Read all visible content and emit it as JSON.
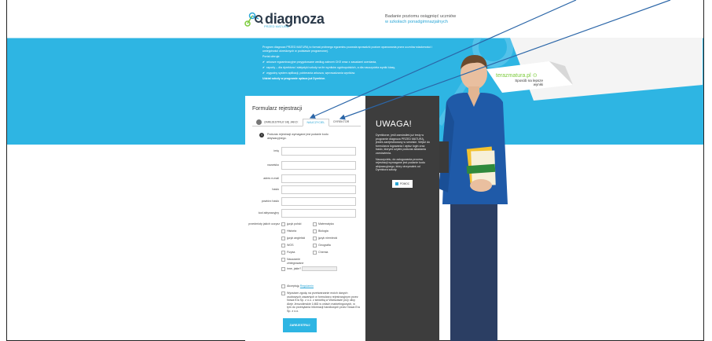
{
  "header": {
    "logo_text": "diagnoza",
    "logo_sub": "PRZED MATURĄ",
    "tagline_line1": "Badanie poziomu osiągnięć uczniów",
    "tagline_line2": "w szkołach ponadgimnazjalnych"
  },
  "banner": {
    "intro": "Program diagnoza PRZED MATURĄ to format próbnego egzaminu pozwala sprawdzić poziom opanowania przez uczniów wiadomości i umiejętności określonych w podstawie programowej.",
    "portal_heading": "Portal oferuje:",
    "features": [
      "arkusze egzaminacyjne przygotowane według zaleceń CKE wraz z zasadami oceniania,",
      "raporty – dla dyrektora i statystyki szkoły na tle wyników ogólnopolskich, a dla nauczyciela wyniki klasy,",
      "wygodny system aplikacji, pobierania arkusza, wprowadzania wyników."
    ],
    "closing": "Udział szkoły w programie opłaca już Dyrektor.",
    "partner_logo": "terazmatura.pl",
    "partner_sub": "Sposób na lepsze wyniki"
  },
  "form": {
    "title": "Formularz rejestracji",
    "tabs": [
      {
        "label": "ZAREJESTRUJ SIĘ JAKO:"
      },
      {
        "label": "NAUCZYCIEL"
      },
      {
        "label": "DYREKTOR"
      }
    ],
    "info": "Podczas rejestracji wymagane jest podanie kodu aktywacyjnego.",
    "fields": [
      {
        "label": "imię"
      },
      {
        "label": "nazwisko"
      },
      {
        "label": "adres e-mail"
      },
      {
        "label": "hasło"
      },
      {
        "label": "powtórz hasło"
      },
      {
        "label": "kod aktywacyjny"
      }
    ],
    "subjects_label": "przedmioty jakich uczysz",
    "subjects_left": [
      "język polski",
      "Historia",
      "język angielski",
      "WOS",
      "Fizyka",
      "Nauczanie zintegrowane"
    ],
    "subjects_right": [
      "Matematyka",
      "Biologia",
      "język niemiecki",
      "Geografia",
      "Chemia"
    ],
    "other_label": "inne, jakie?",
    "accept_text": "Akceptuję",
    "accept_link": "Regulamin",
    "consent_text": "Wyrażam zgodę na przetwarzanie moich danych osobowych zawartych w formularzu rejestracyjnym przez Nowa Era Sp. z o.o. z siedzibą w Warszawie przy ulicy Aleje Jerozolimskie 146D w celach marketingowych, w tym do przesyłania informacji handlowych przez Nowa Era Sp. z o.o.",
    "submit": "ZAREJESTRUJ"
  },
  "warning": {
    "title": "UWAGA!",
    "p1": "Dyrektorze, jeśli zamówiłeś już testy w programie diagnoza PRZED MATURĄ, jesteś zarejestrowany w serwisie. Wejdź do formularza logowania i wpisz login oraz hasło, którymi użyłeś podczas składania zamówienia.",
    "p2": "Nauczycielu, do zalogowania procesu rejestracji wymagane jest podanie kodu aktywacyjnego, który otrzymałeś od Dyrektora szkoły.",
    "button": "POMOC"
  },
  "colors": {
    "banner": "#2eb5e3",
    "warn_panel": "#3d3d3d",
    "accent": "#2aa6d6",
    "partner_green": "#7ccb3c"
  }
}
